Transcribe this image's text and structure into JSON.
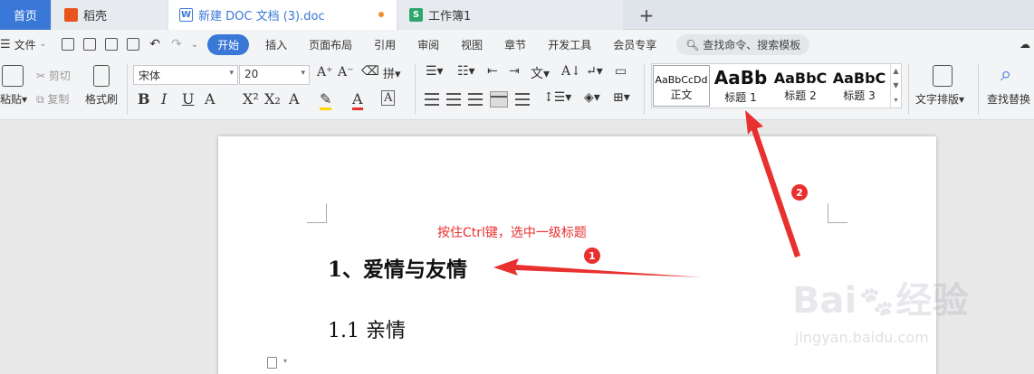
{
  "tabs": {
    "home": "首页",
    "daoke": "稻壳",
    "doc": "新建 DOC 文档 (3).doc",
    "sheet": "工作簿1",
    "add": "+"
  },
  "menu": {
    "file": "文件",
    "items": [
      "开始",
      "插入",
      "页面布局",
      "引用",
      "审阅",
      "视图",
      "章节",
      "开发工具",
      "会员专享"
    ],
    "search": "查找命令、搜索模板"
  },
  "ribbon": {
    "paste": "粘贴",
    "cut": "剪切",
    "copy": "复制",
    "format_painter": "格式刷",
    "font_name": "宋体",
    "font_size": "20",
    "styles": [
      {
        "sample": "AaBbCcDd",
        "name": "正文"
      },
      {
        "sample": "AaBb",
        "name": "标题 1"
      },
      {
        "sample": "AaBbC",
        "name": "标题 2"
      },
      {
        "sample": "AaBbC",
        "name": "标题 3"
      }
    ],
    "text_layout": "文字排版",
    "find_replace": "查找替换"
  },
  "document": {
    "heading1": "1、爱情与友情",
    "heading2": "1.1 亲情"
  },
  "annotations": {
    "instruction": "按住Ctrl键，选中一级标题",
    "badge1": "1",
    "badge2": "2",
    "color": "#e8302f"
  },
  "watermark": {
    "url": "jingyan.baidu.com"
  },
  "colors": {
    "accent": "#3a78d8",
    "annotation": "#e8302f"
  }
}
